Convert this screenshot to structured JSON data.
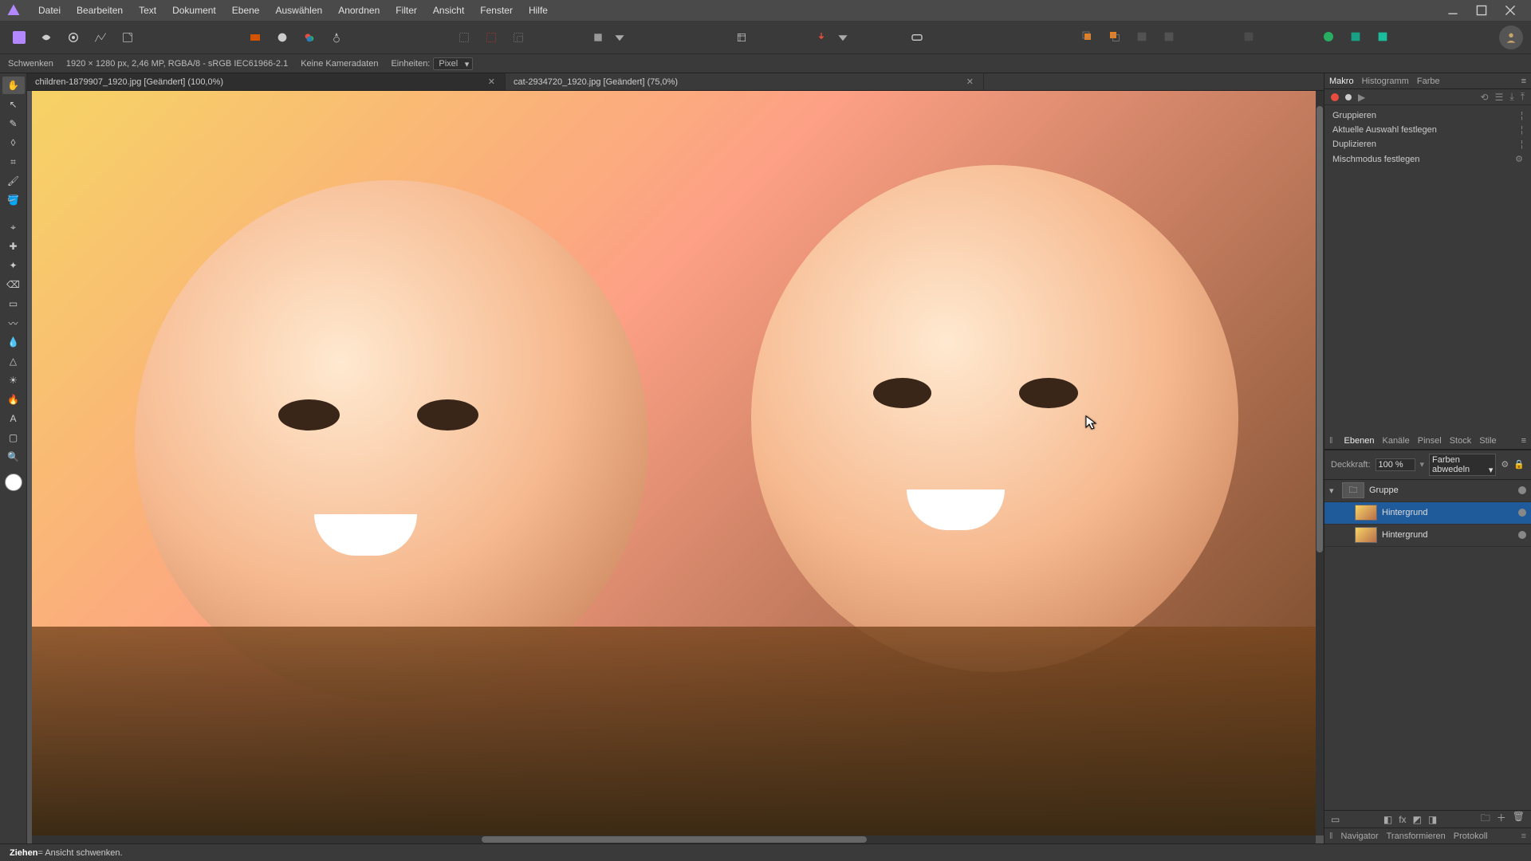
{
  "menu": {
    "items": [
      "Datei",
      "Bearbeiten",
      "Text",
      "Dokument",
      "Ebene",
      "Auswählen",
      "Anordnen",
      "Filter",
      "Ansicht",
      "Fenster",
      "Hilfe"
    ]
  },
  "contextbar": {
    "tool_name": "Schwenken",
    "doc_info": "1920 × 1280 px, 2,46 MP, RGBA/8 - sRGB IEC61966-2.1",
    "camera": "Keine Kameradaten",
    "units_label": "Einheiten:",
    "units_value": "Pixel"
  },
  "document_tabs": [
    {
      "title": "children-1879907_1920.jpg [Geändert] (100,0%)",
      "selected": true
    },
    {
      "title": "cat-2934720_1920.jpg [Geändert] (75,0%)",
      "selected": false
    }
  ],
  "panels_top": {
    "tabs": [
      "Makro",
      "Histogramm",
      "Farbe"
    ],
    "selected": "Makro",
    "macro_actions": [
      {
        "label": "Gruppieren",
        "gear": false
      },
      {
        "label": "Aktuelle Auswahl festlegen",
        "gear": false
      },
      {
        "label": "Duplizieren",
        "gear": false
      },
      {
        "label": "Mischmodus festlegen",
        "gear": true
      }
    ]
  },
  "layers_panel": {
    "tabs": [
      "Ebenen",
      "Kanäle",
      "Pinsel",
      "Stock",
      "Stile"
    ],
    "selected": "Ebenen",
    "opacity_label": "Deckkraft:",
    "opacity_value": "100 %",
    "blend_value": "Farben abwedeln",
    "tree": [
      {
        "name": "Gruppe",
        "type": "group",
        "selected": false,
        "indent": 0,
        "disclose": true
      },
      {
        "name": "Hintergrund",
        "type": "pixel",
        "selected": true,
        "indent": 1
      },
      {
        "name": "Hintergrund",
        "type": "pixel",
        "selected": false,
        "indent": 1
      }
    ]
  },
  "bottom_panel_tabs": [
    "Navigator",
    "Transformieren",
    "Protokoll"
  ],
  "status": {
    "action": "Ziehen",
    "hint": " = Ansicht schwenken."
  },
  "left_tools": [
    "hand",
    "move",
    "pen",
    "node",
    "crop",
    "paintbrush",
    "fill",
    "spacer",
    "clone",
    "heal",
    "inpaint",
    "eraser",
    "selection",
    "smudge",
    "blur",
    "sharpen",
    "dodge",
    "burn",
    "text",
    "shape",
    "zoom"
  ],
  "colors": {
    "accent": "#1f5a9b",
    "bg": "#3a3a3a"
  }
}
